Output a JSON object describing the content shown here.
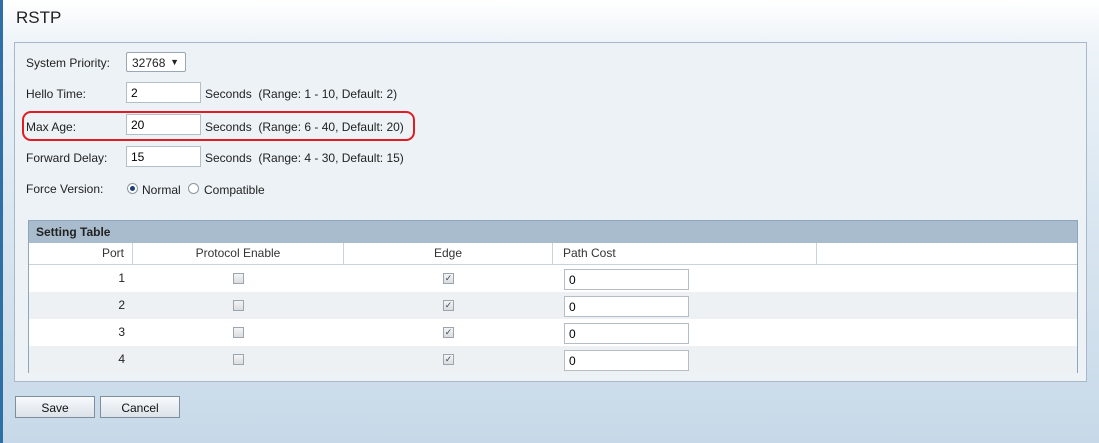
{
  "page": {
    "title": "RSTP"
  },
  "form": {
    "system_priority": {
      "label": "System Priority:",
      "value": "32768"
    },
    "hello_time": {
      "label": "Hello Time:",
      "value": "2",
      "units": "Seconds",
      "range": "(Range: 1 - 10, Default: 2)"
    },
    "max_age": {
      "label": "Max Age:",
      "value": "20",
      "units": "Seconds",
      "range": "(Range: 6 - 40, Default: 20)"
    },
    "forward_delay": {
      "label": "Forward Delay:",
      "value": "15",
      "units": "Seconds",
      "range": "(Range: 4 - 30, Default: 15)"
    },
    "force_version": {
      "label": "Force Version:",
      "options": [
        "Normal",
        "Compatible"
      ],
      "selected": "Normal"
    }
  },
  "table": {
    "title": "Setting Table",
    "columns": [
      "Port",
      "Protocol Enable",
      "Edge",
      "Path Cost"
    ],
    "rows": [
      {
        "port": "1",
        "protocol_enable": false,
        "edge": true,
        "path_cost": "0"
      },
      {
        "port": "2",
        "protocol_enable": false,
        "edge": true,
        "path_cost": "0"
      },
      {
        "port": "3",
        "protocol_enable": false,
        "edge": true,
        "path_cost": "0"
      },
      {
        "port": "4",
        "protocol_enable": false,
        "edge": true,
        "path_cost": "0"
      }
    ]
  },
  "buttons": {
    "save": "Save",
    "cancel": "Cancel"
  },
  "colors": {
    "highlight": "#e01c24",
    "table_header": "#a9bccd",
    "sidebar": "#2f6fa8"
  }
}
